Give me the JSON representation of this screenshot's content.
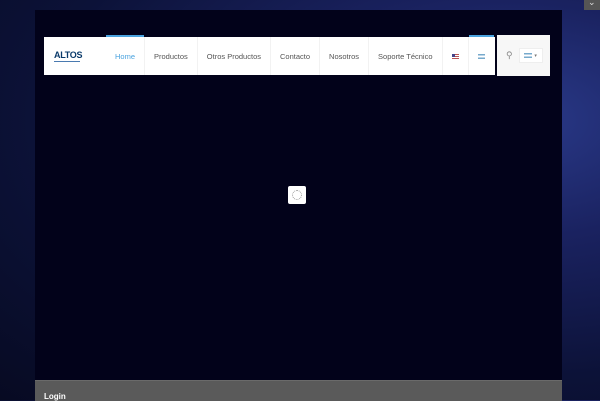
{
  "logo": {
    "text": "ALTOS"
  },
  "nav": {
    "items": [
      "Home",
      "Productos",
      "Otros Productos",
      "Contacto",
      "Nosotros",
      "Soporte Técnico"
    ],
    "active": "Home"
  },
  "icons": {
    "flag_en": "us-flag-icon",
    "flag_es": "argentina-flag-icon",
    "search": "search-icon",
    "spinner": "loading-spinner-icon"
  },
  "colors": {
    "accent": "#4aa3df",
    "page_bg": "#02021a",
    "footer_bg": "#5a5a5a"
  },
  "footer": {
    "title": "Login"
  }
}
